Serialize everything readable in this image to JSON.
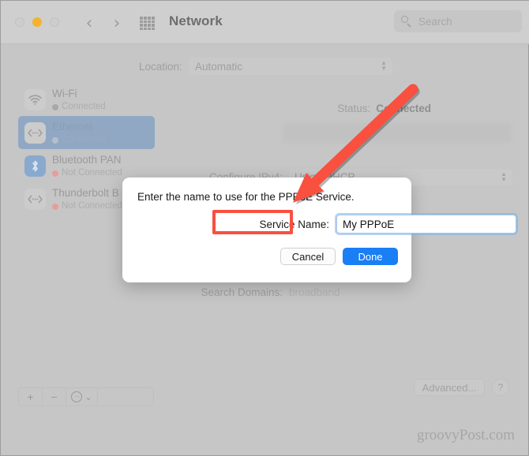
{
  "window": {
    "title": "Network",
    "traffic_lights": [
      "close-button",
      "minimize-button",
      "maximize-button"
    ],
    "nav_back": "‹",
    "nav_forward": "›",
    "grid_icon": "grid-icon"
  },
  "search": {
    "placeholder": "Search",
    "value": "",
    "icon": "search-icon"
  },
  "location": {
    "label": "Location:",
    "value": "Automatic",
    "options": [
      "Automatic"
    ]
  },
  "sidebar": {
    "items": [
      {
        "name": "Wi-Fi",
        "status": "Connected",
        "dot": "grey",
        "icon": "wifi-icon",
        "selected": false
      },
      {
        "name": "Ethernet",
        "status": "Connected",
        "dot": "grey",
        "icon": "ethernet-icon",
        "selected": true
      },
      {
        "name": "Bluetooth PAN",
        "status": "Not Connected",
        "dot": "red",
        "icon": "bluetooth-icon",
        "selected": false
      },
      {
        "name": "Thunderbolt B",
        "status": "Not Connected",
        "dot": "red",
        "icon": "thunderbolt-icon",
        "selected": false
      }
    ],
    "toolbar": {
      "add": "+",
      "remove": "−",
      "action": "⋯",
      "chevron": "⌄"
    }
  },
  "main": {
    "status_label": "Status:",
    "status_value": "Connected",
    "ipv4_label": "Configure IPv4:",
    "ipv4_value": "Using DHCP",
    "search_domains_label": "Search Domains:",
    "search_domains_value": "broadband",
    "advanced_label": "Advanced...",
    "help_label": "?"
  },
  "sheet": {
    "title": "Enter the name to use for the PPPoE Service.",
    "field_label": "Service Name:",
    "field_value": "My PPPoE",
    "field_placeholder": "",
    "cancel_label": "Cancel",
    "done_label": "Done"
  },
  "annotations": {
    "arrow_color": "#f9503f",
    "highlight_color": "#f9503f",
    "highlight_target": "service-name-input"
  },
  "watermark": "groovyPost.com",
  "colors": {
    "accent_blue": "#1a7ef5",
    "selection_blue": "#91a8c4",
    "annotation_red": "#f9503f",
    "window_bg": "#c6c6c6",
    "toolbar_bg": "#cfcfcf",
    "minimize_yellow": "#f5b32b"
  }
}
